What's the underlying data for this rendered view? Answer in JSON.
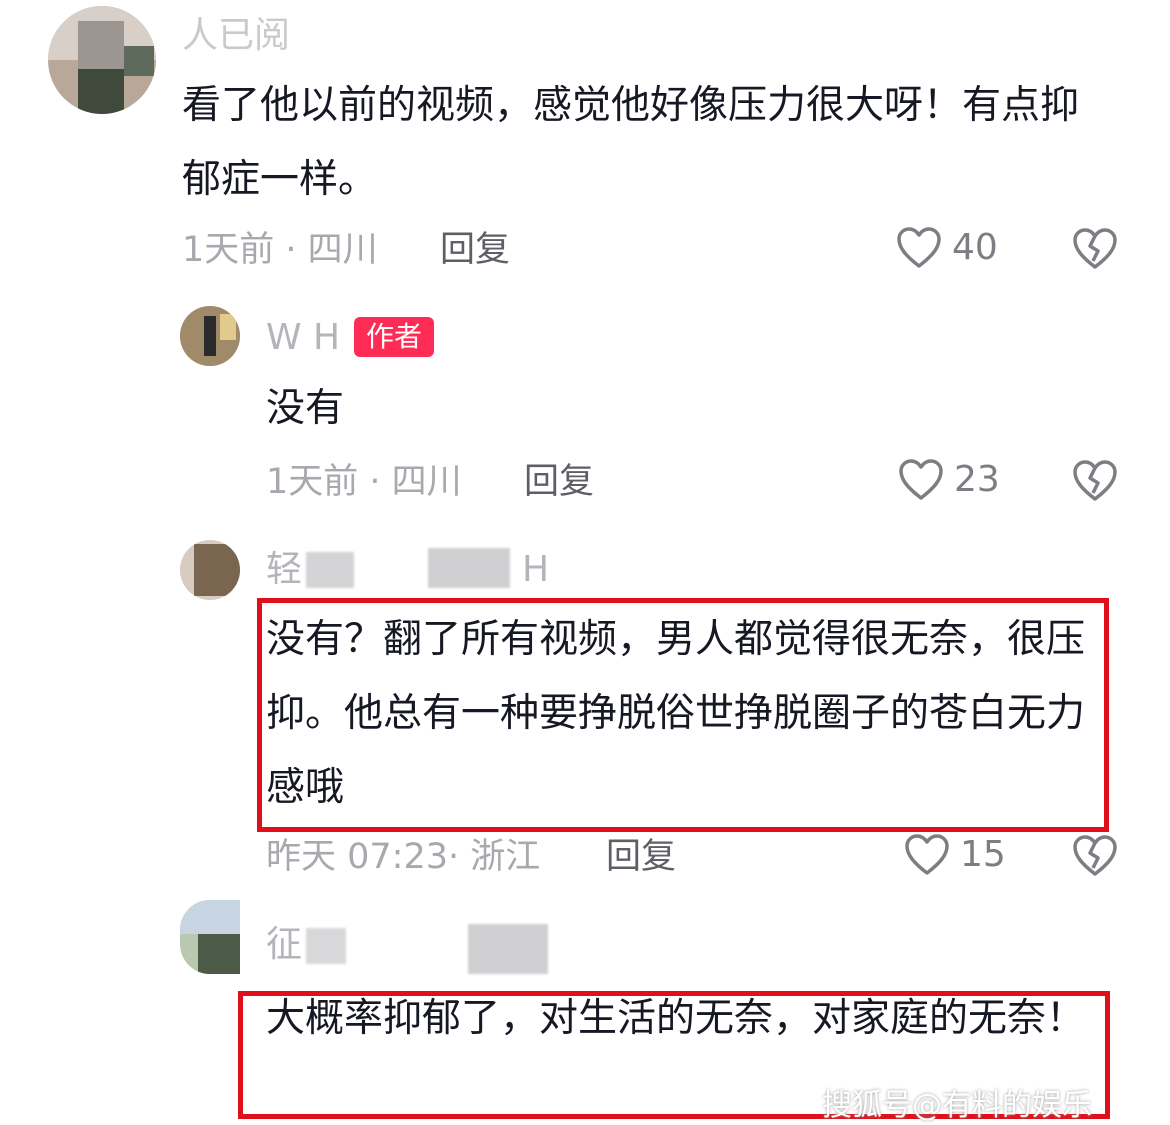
{
  "comments": [
    {
      "name": "人已阅",
      "text": "看了他以前的视频，感觉他好像压力很大呀！有点抑郁症一样。",
      "time": "1天前 · 四川",
      "reply": "回复",
      "likes": "40"
    },
    {
      "name": "W H",
      "badge": "作者",
      "text": "没有",
      "time": "1天前 · 四川",
      "reply": "回复",
      "likes": "23"
    },
    {
      "name_prefix": "轻",
      "name_suffix": "H",
      "text": "没有？翻了所有视频，男人都觉得很无奈，很压抑。他总有一种要挣脱俗世挣脱圈子的苍白无力感哦",
      "time": "昨天 07:23· 浙江",
      "reply": "回复",
      "likes": "15"
    },
    {
      "name_prefix": "征",
      "text": "大概率抑郁了，对生活的无奈，对家庭的无奈！"
    }
  ],
  "watermark": "搜狐号@有料的娱乐",
  "colors": {
    "highlight": "#e0101a",
    "badge": "#fe2c55",
    "text": "#161823",
    "meta": "#a8a9ae"
  },
  "icons": {
    "like": "heart-outline-icon",
    "dislike": "broken-heart-icon"
  }
}
